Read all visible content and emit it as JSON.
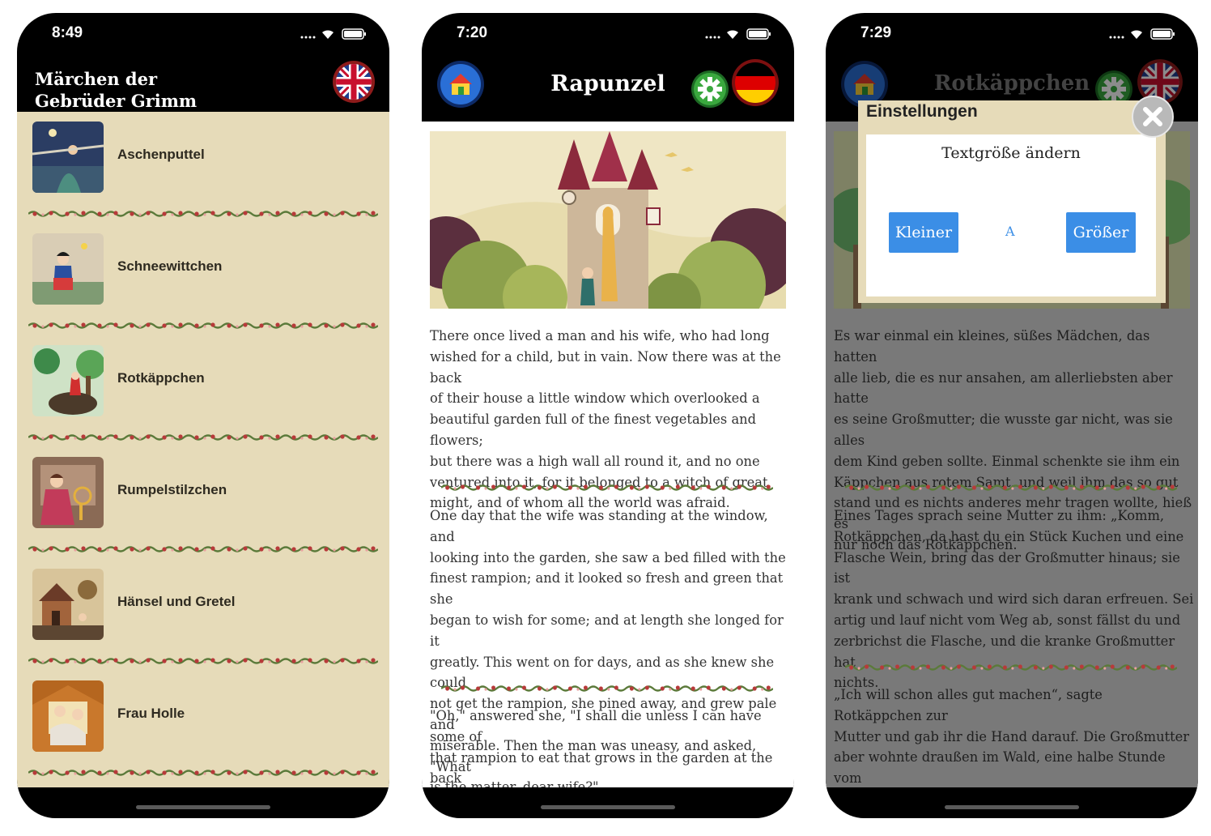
{
  "phone1": {
    "time": "8:49",
    "app_title": "Märchen der\nGebrüder Grimm",
    "stories": [
      {
        "title": "Aschenputtel",
        "thumb": "cinderella-thumb"
      },
      {
        "title": "Schneewittchen",
        "thumb": "snow-white-thumb"
      },
      {
        "title": "Rotkäppchen",
        "thumb": "red-riding-hood-thumb"
      },
      {
        "title": "Rumpelstilzchen",
        "thumb": "rumpelstiltskin-thumb"
      },
      {
        "title": "Hänsel und Gretel",
        "thumb": "hansel-gretel-thumb"
      },
      {
        "title": "Frau Holle",
        "thumb": "frau-holle-thumb"
      }
    ]
  },
  "phone2": {
    "time": "7:20",
    "title": "Rapunzel",
    "paragraphs": [
      "There once lived a man and his wife, who had long\nwished for a child, but in vain. Now there was at the back\nof their house a little window which overlooked a\nbeautiful garden full of the finest vegetables and flowers;\nbut there was a high wall all round it, and no one\nventured into it, for it belonged to a witch of great\nmight, and of whom all the world was afraid.",
      "One day that the wife was standing at the window, and\nlooking into the garden, she saw a bed filled with the\nfinest rampion; and it looked so fresh and green that she\nbegan to wish for some; and at length she longed for it\ngreatly. This went on for days, and as she knew she could\nnot get the rampion, she pined away, and grew pale and\nmiserable. Then the man was uneasy, and asked, \"What\nis the matter, dear wife?\"",
      "\"Oh,\" answered she, \"I shall die unless I can have some of\nthat rampion to eat that grows in the garden at the back\nof our house.\" The man, who loved her very much,\nthought to himself, \"Rather than lose my wife I will get"
    ]
  },
  "phone3": {
    "time": "7:29",
    "title": "Rotkäppchen",
    "paragraphs": [
      "Es war einmal ein kleines, süßes Mädchen, das hatten\nalle lieb, die es nur ansahen, am allerliebsten aber hatte\nes seine Großmutter; die wusste gar nicht, was sie alles\ndem Kind geben sollte. Einmal schenkte sie ihm ein\nKäppchen aus rotem Samt, und weil ihm das so gut\nstand und es nichts anderes mehr tragen wollte, hieß es\nnur noch das Rotkäppchen.",
      "Eines Tages sprach seine Mutter zu ihm: „Komm,\nRotkäppchen, da hast du ein Stück Kuchen und eine\nFlasche Wein, bring das der Großmutter hinaus; sie ist\nkrank und schwach und wird sich daran erfreuen. Sei\nartig und lauf nicht vom Weg ab, sonst fällst du und\nzerbrichst die Flasche, und die kranke Großmutter hat\nnichts.",
      "„Ich will schon alles gut machen“, sagte Rotkäppchen zur\nMutter und gab ihr die Hand darauf. Die Großmutter\naber wohnte draußen im Wald, eine halbe Stunde vom\nDorf. Als Rotkäppchen nun in den Wald kam, begegnete\nihm der Wolf. Rotkäppchen aber wusste nicht, was das"
    ],
    "modal": {
      "title": "Einstellungen",
      "subtitle": "Textgröße ändern",
      "smaller": "Kleiner",
      "sample": "A",
      "bigger": "Größer"
    }
  },
  "colors": {
    "parchment": "#e6dbb9",
    "button_blue": "#3b8ee6",
    "header_black": "#000000"
  }
}
